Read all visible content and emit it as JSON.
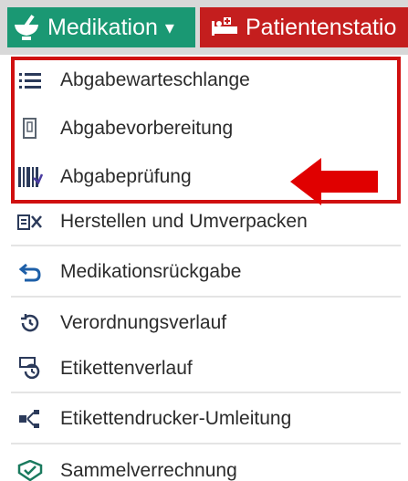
{
  "toolbar": {
    "medication_tab": {
      "label": "Medikation",
      "caret": "▾",
      "color": "#1a9873"
    },
    "patient_tab": {
      "label": "Patientenstatio",
      "color": "#c41e1e"
    }
  },
  "menu": {
    "items": [
      {
        "label": "Abgabewarteschlange",
        "icon": "list-icon"
      },
      {
        "label": "Abgabevorbereitung",
        "icon": "document-icon"
      },
      {
        "label": "Abgabeprüfung",
        "icon": "barcode-icon"
      },
      {
        "label": "Herstellen und Umverpacken",
        "icon": "repack-icon"
      },
      {
        "label": "Medikationsrückgabe",
        "icon": "return-arrow-icon"
      },
      {
        "label": "Verordnungsverlauf",
        "icon": "history-icon"
      },
      {
        "label": "Etikettenverlauf",
        "icon": "label-history-icon"
      },
      {
        "label": "Etikettendrucker-Umleitung",
        "icon": "printer-redirect-icon"
      },
      {
        "label": "Sammelverrechnung",
        "icon": "billing-icon"
      }
    ]
  },
  "annotation": {
    "highlight_color": "#d01010",
    "arrow_color": "#e00000"
  }
}
